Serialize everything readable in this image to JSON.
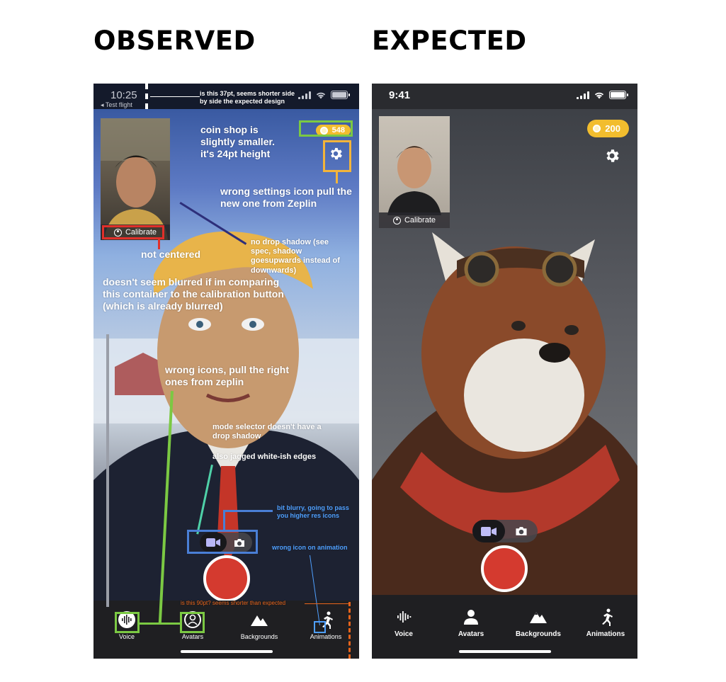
{
  "headings": {
    "observed": "OBSERVED",
    "expected": "EXPECTED"
  },
  "observed": {
    "status_time": "10:25",
    "back_app": "◂ Test flight",
    "coins": "548",
    "calibrate": "Calibrate",
    "tabs": [
      "Voice",
      "Avatars",
      "Backgrounds",
      "Animations"
    ]
  },
  "expected": {
    "status_time": "9:41",
    "coins": "200",
    "calibrate": "Calibrate",
    "tabs": [
      "Voice",
      "Avatars",
      "Backgrounds",
      "Animations"
    ]
  },
  "annotations": {
    "status_height": "is this 37pt, seems shorter side by side the expected design",
    "coin_shop": "coin shop is slightly smaller. it's 24pt height",
    "settings_icon": "wrong settings icon pull the new one from Zeplin",
    "not_centered": "not centered",
    "drop_shadow": "no drop shadow (see spec, shadow goesupwards instead of downwards)",
    "blur": "doesn't seem blurred if im comparing this container to the calibration button (which is already blurred)",
    "wrong_icons": "wrong icons, pull the right ones from zeplin",
    "mode_shadow": "mode selector doesn't have a drop shadow",
    "jagged": "also jagged white-ish edges",
    "blurry_icons": "bit blurry, going to pass you higher res icons",
    "wrong_anim_icon": "wrong icon on animation",
    "tabbar_height": "is this 90pt? seems shorter than expected"
  },
  "colors": {
    "record": "#d43a2f",
    "coin": "#f2bd2e",
    "annotation_red": "#e0302a",
    "annotation_green": "#7bc943",
    "annotation_yellow": "#f3b43a",
    "annotation_blue": "#4a7fd6",
    "annotation_navy": "#2d2f7a",
    "annotation_teal": "#4fd1a8",
    "annotation_orange": "#e8641b"
  }
}
